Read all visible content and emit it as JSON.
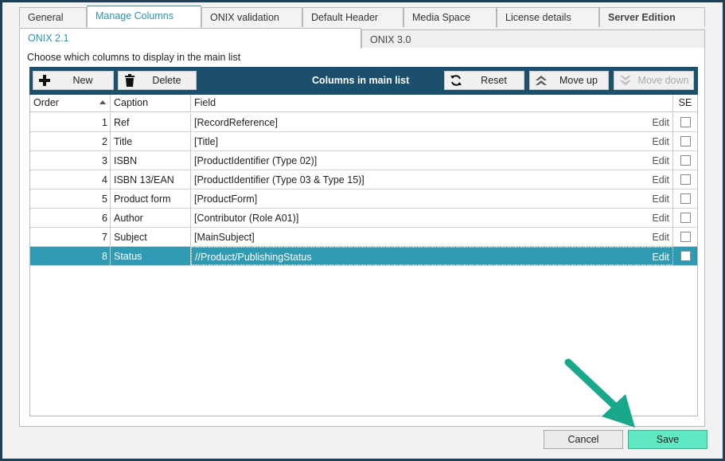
{
  "tabs": [
    {
      "label": "General"
    },
    {
      "label": "Manage Columns"
    },
    {
      "label": "ONIX validation"
    },
    {
      "label": "Default Header"
    },
    {
      "label": "Media Space"
    },
    {
      "label": "License details"
    },
    {
      "label": "Server Edition"
    }
  ],
  "subtabs": [
    {
      "label": "ONIX 2.1"
    },
    {
      "label": "ONIX 3.0"
    }
  ],
  "hint": "Choose which columns to display in the main list",
  "toolbar": {
    "new_label": "New",
    "delete_label": "Delete",
    "title": "Columns in main list",
    "reset_label": "Reset",
    "move_up_label": "Move up",
    "move_down_label": "Move down"
  },
  "grid": {
    "headers": {
      "order": "Order",
      "caption": "Caption",
      "field": "Field",
      "se": "SE"
    },
    "edit_label": "Edit",
    "rows": [
      {
        "order": "1",
        "caption": "Ref",
        "field": "[RecordReference]",
        "selected": false
      },
      {
        "order": "2",
        "caption": "Title",
        "field": "[Title]",
        "selected": false
      },
      {
        "order": "3",
        "caption": "ISBN",
        "field": "[ProductIdentifier (Type 02)]",
        "selected": false
      },
      {
        "order": "4",
        "caption": "ISBN 13/EAN",
        "field": "[ProductIdentifier (Type 03 & Type 15)]",
        "selected": false
      },
      {
        "order": "5",
        "caption": "Product form",
        "field": "[ProductForm]",
        "selected": false
      },
      {
        "order": "6",
        "caption": "Author",
        "field": "[Contributor (Role A01)]",
        "selected": false
      },
      {
        "order": "7",
        "caption": "Subject",
        "field": "[MainSubject]",
        "selected": false
      },
      {
        "order": "8",
        "caption": "Status",
        "field": "//Product/PublishingStatus",
        "selected": true
      }
    ]
  },
  "buttons": {
    "cancel": "Cancel",
    "save": "Save"
  },
  "colors": {
    "accent": "#2a95ad",
    "toolbar": "#1b4f6c",
    "selected_row": "#2e9bb3",
    "save": "#5fe8c2",
    "arrow": "#1aa88a"
  }
}
